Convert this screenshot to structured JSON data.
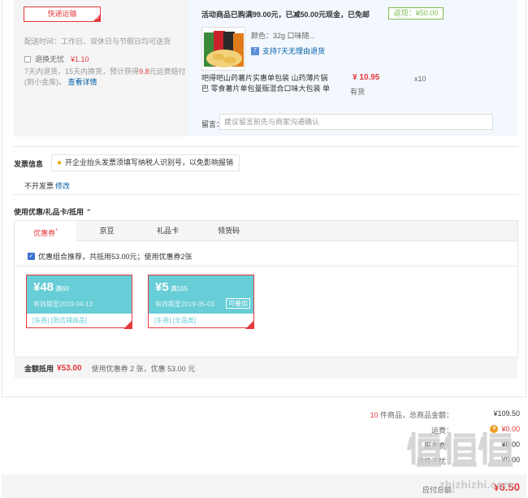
{
  "shipping": {
    "button_label": "快递运输",
    "delivery_time": "配送时间：工作日、双休日与节假日均可送货",
    "return_insurance_label": "退换无忧",
    "return_insurance_price": "¥1.10",
    "return_desc_1": "7天内退货，15天内换货，预计获得",
    "return_desc_amount": "9.8",
    "return_desc_2": "元运费赔付(到小金库)。",
    "details_link": "查看详情"
  },
  "promo": {
    "line": "活动商品已购满99.00元，已减50.00元现金，已免邮",
    "rebate": "返现：¥50.00"
  },
  "product": {
    "spec": "颜色：32g 口味随...",
    "support": "支持7天无理由退货",
    "support_badge": "7",
    "name": "吧得吧山药薯片实惠单包装 山药薄片锅巴 零食薯片单包量贩混合口味大包装 单",
    "price": "¥ 10.95",
    "stock": "有货",
    "qty": "x10"
  },
  "note": {
    "label": "留言：",
    "placeholder": "建议留言前先与商家沟通确认"
  },
  "invoice": {
    "title": "发票信息",
    "tip": "开企业抬头发票须填写纳税人识别号，以免影响报销",
    "value": "不开发票",
    "edit": "修改"
  },
  "discount": {
    "title": "使用优惠/礼品卡/抵用",
    "tabs": [
      "优惠券",
      "京豆",
      "礼品卡",
      "领货码"
    ],
    "tab_mark": "*",
    "combo_text": "优惠组合推荐，共抵用53.00元；使用优惠券2张",
    "coupons": [
      {
        "amount": "¥48",
        "condition": "满60",
        "expire": "有效期至2019-04-13",
        "scope": "[东券] [限店铺商品]",
        "stack": ""
      },
      {
        "amount": "¥5",
        "condition": "满105",
        "expire": "有效期至2019-05-03",
        "scope": "[东券] [全品类]",
        "stack": "可叠加"
      }
    ],
    "deduct_label": "金额抵用",
    "deduct_amount": "¥53.00",
    "deduct_desc": "使用优惠券 2 张，优惠 53.00 元"
  },
  "summary": {
    "count_num": "10",
    "count_text": "件商品，总商品金额：",
    "count_val": "¥109.50",
    "freight_label": "运费：",
    "freight_val": "¥0.00",
    "service_label": "服务费：",
    "service_val": "¥0.00",
    "return_label": "退换无忧：",
    "return_val": "¥0.00",
    "total_label": "应付总额：",
    "total_val": "¥6.50"
  },
  "watermark": {
    "brand": "值",
    "site": "zhizhizhi.com"
  },
  "colors": {
    "accent_red": "#e4393c",
    "coupon_teal": "#67cdd6",
    "link_blue": "#005ea7",
    "rebate_green": "#7abd54"
  }
}
